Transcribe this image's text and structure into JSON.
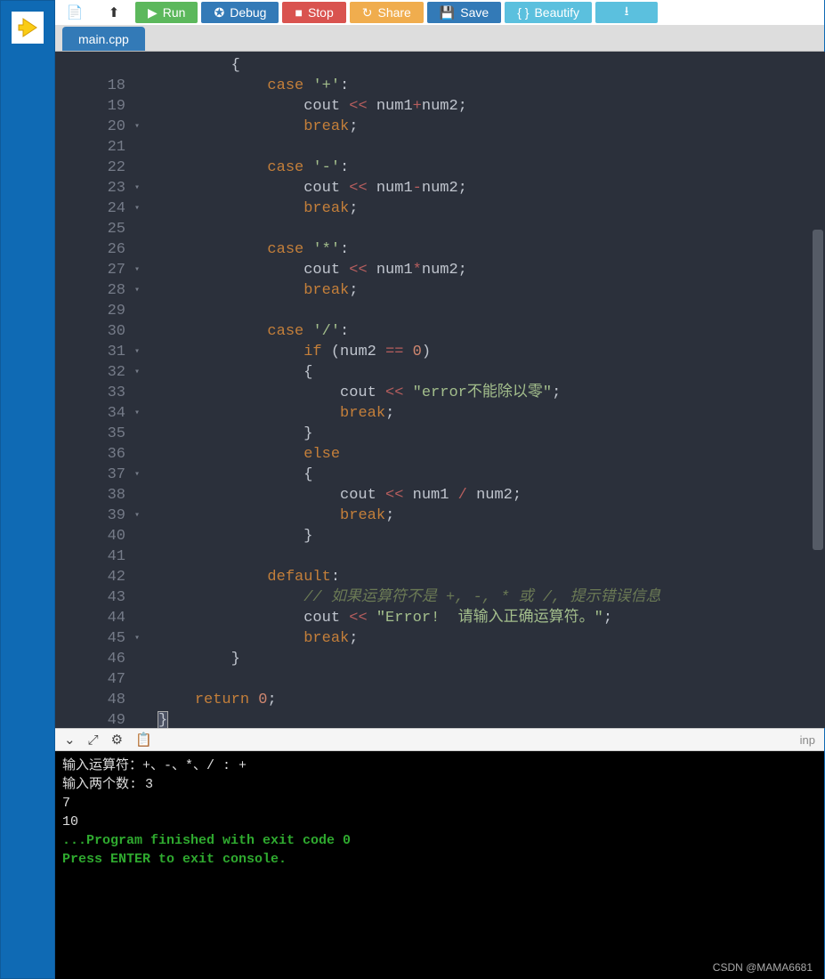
{
  "toolbar": {
    "run": "Run",
    "debug": "Debug",
    "stop": "Stop",
    "share": "Share",
    "save": "Save",
    "beautify": "Beautify"
  },
  "tab": {
    "name": "main.cpp"
  },
  "gutter": {
    "start": 18,
    "end": 49,
    "foldable": [
      20,
      23,
      24,
      27,
      28,
      31,
      32,
      34,
      37,
      39,
      45
    ]
  },
  "code": {
    "rows": [
      {
        "n": "",
        "t": [
          [
            "op",
            "        {"
          ]
        ]
      },
      {
        "n": 18,
        "t": [
          [
            "op",
            "            "
          ],
          [
            "kw",
            "case"
          ],
          [
            "op",
            " "
          ],
          [
            "str",
            "'+'"
          ],
          [
            "op",
            ":"
          ]
        ]
      },
      {
        "n": 19,
        "t": [
          [
            "op",
            "                cout "
          ],
          [
            "red",
            "<<"
          ],
          [
            "op",
            " num1"
          ],
          [
            "red",
            "+"
          ],
          [
            "op",
            "num2;"
          ]
        ]
      },
      {
        "n": 20,
        "t": [
          [
            "op",
            "                "
          ],
          [
            "kw",
            "break"
          ],
          [
            "op",
            ";"
          ]
        ]
      },
      {
        "n": 21,
        "t": [
          [
            "op",
            ""
          ]
        ]
      },
      {
        "n": 22,
        "t": [
          [
            "op",
            "            "
          ],
          [
            "kw",
            "case"
          ],
          [
            "op",
            " "
          ],
          [
            "str",
            "'-'"
          ],
          [
            "op",
            ":"
          ]
        ]
      },
      {
        "n": 23,
        "t": [
          [
            "op",
            "                cout "
          ],
          [
            "red",
            "<<"
          ],
          [
            "op",
            " num1"
          ],
          [
            "red",
            "-"
          ],
          [
            "op",
            "num2;"
          ]
        ]
      },
      {
        "n": 24,
        "t": [
          [
            "op",
            "                "
          ],
          [
            "kw",
            "break"
          ],
          [
            "op",
            ";"
          ]
        ]
      },
      {
        "n": 25,
        "t": [
          [
            "op",
            ""
          ]
        ]
      },
      {
        "n": 26,
        "t": [
          [
            "op",
            "            "
          ],
          [
            "kw",
            "case"
          ],
          [
            "op",
            " "
          ],
          [
            "str",
            "'*'"
          ],
          [
            "op",
            ":"
          ]
        ]
      },
      {
        "n": 27,
        "t": [
          [
            "op",
            "                cout "
          ],
          [
            "red",
            "<<"
          ],
          [
            "op",
            " num1"
          ],
          [
            "red",
            "*"
          ],
          [
            "op",
            "num2;"
          ]
        ]
      },
      {
        "n": 28,
        "t": [
          [
            "op",
            "                "
          ],
          [
            "kw",
            "break"
          ],
          [
            "op",
            ";"
          ]
        ]
      },
      {
        "n": 29,
        "t": [
          [
            "op",
            ""
          ]
        ]
      },
      {
        "n": 30,
        "t": [
          [
            "op",
            "            "
          ],
          [
            "kw",
            "case"
          ],
          [
            "op",
            " "
          ],
          [
            "str",
            "'/'"
          ],
          [
            "op",
            ":"
          ]
        ]
      },
      {
        "n": 31,
        "t": [
          [
            "op",
            "                "
          ],
          [
            "kw",
            "if"
          ],
          [
            "op",
            " (num2 "
          ],
          [
            "red",
            "=="
          ],
          [
            "op",
            " "
          ],
          [
            "num",
            "0"
          ],
          [
            "op",
            ")"
          ]
        ]
      },
      {
        "n": 32,
        "t": [
          [
            "op",
            "                {"
          ]
        ]
      },
      {
        "n": 33,
        "t": [
          [
            "op",
            "                    cout "
          ],
          [
            "red",
            "<<"
          ],
          [
            "op",
            " "
          ],
          [
            "str",
            "\"error不能除以零\""
          ],
          [
            "op",
            ";"
          ]
        ]
      },
      {
        "n": 34,
        "t": [
          [
            "op",
            "                    "
          ],
          [
            "kw",
            "break"
          ],
          [
            "op",
            ";"
          ]
        ]
      },
      {
        "n": 35,
        "t": [
          [
            "op",
            "                }"
          ]
        ]
      },
      {
        "n": 36,
        "t": [
          [
            "op",
            "                "
          ],
          [
            "kw",
            "else"
          ]
        ]
      },
      {
        "n": 37,
        "t": [
          [
            "op",
            "                {"
          ]
        ]
      },
      {
        "n": 38,
        "t": [
          [
            "op",
            "                    cout "
          ],
          [
            "red",
            "<<"
          ],
          [
            "op",
            " num1 "
          ],
          [
            "red",
            "/"
          ],
          [
            "op",
            " num2;"
          ]
        ]
      },
      {
        "n": 39,
        "t": [
          [
            "op",
            "                    "
          ],
          [
            "kw",
            "break"
          ],
          [
            "op",
            ";"
          ]
        ]
      },
      {
        "n": 40,
        "t": [
          [
            "op",
            "                }"
          ]
        ]
      },
      {
        "n": 41,
        "t": [
          [
            "op",
            ""
          ]
        ]
      },
      {
        "n": 42,
        "t": [
          [
            "op",
            "            "
          ],
          [
            "kw",
            "default"
          ],
          [
            "op",
            ":"
          ]
        ]
      },
      {
        "n": 43,
        "t": [
          [
            "op",
            "                "
          ],
          [
            "cmt",
            "// 如果运算符不是 +, -, * 或 /, 提示错误信息"
          ]
        ]
      },
      {
        "n": 44,
        "t": [
          [
            "op",
            "                cout "
          ],
          [
            "red",
            "<<"
          ],
          [
            "op",
            " "
          ],
          [
            "str",
            "\"Error!  请输入正确运算符。\""
          ],
          [
            "op",
            ";"
          ]
        ]
      },
      {
        "n": 45,
        "t": [
          [
            "op",
            "                "
          ],
          [
            "kw",
            "break"
          ],
          [
            "op",
            ";"
          ]
        ]
      },
      {
        "n": 46,
        "t": [
          [
            "op",
            "        }"
          ]
        ]
      },
      {
        "n": 47,
        "t": [
          [
            "op",
            ""
          ]
        ]
      },
      {
        "n": 48,
        "t": [
          [
            "op",
            "    "
          ],
          [
            "kw",
            "return"
          ],
          [
            "op",
            " "
          ],
          [
            "num",
            "0"
          ],
          [
            "op",
            ";"
          ]
        ]
      },
      {
        "n": 49,
        "t": [
          [
            "brace",
            "}"
          ]
        ]
      }
    ]
  },
  "consolebar": {
    "right": "inp"
  },
  "console": {
    "lines": [
      {
        "c": "",
        "t": "输入运算符：+、-、*、/ : +"
      },
      {
        "c": "",
        "t": "输入两个数: 3"
      },
      {
        "c": "",
        "t": "7"
      },
      {
        "c": "",
        "t": "10"
      },
      {
        "c": "",
        "t": ""
      },
      {
        "c": "g",
        "t": "...Program finished with exit code 0"
      },
      {
        "c": "g",
        "t": "Press ENTER to exit console."
      }
    ]
  },
  "watermark": "CSDN @MAMA6681"
}
